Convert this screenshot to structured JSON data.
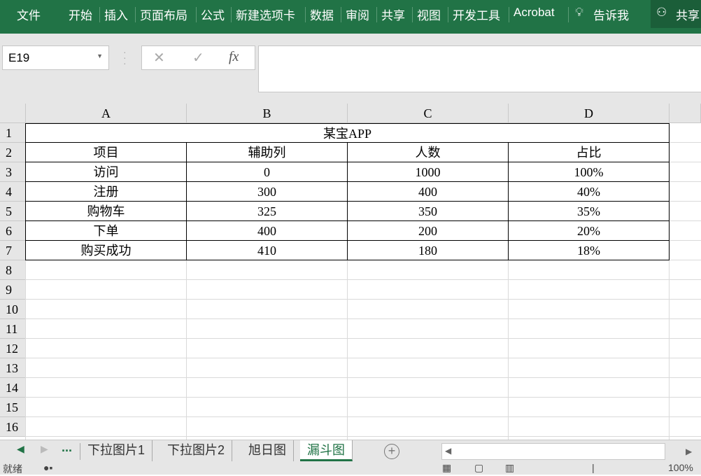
{
  "ribbon": {
    "tabs": [
      "文件",
      "开始",
      "插入",
      "页面布局",
      "公式",
      "新建选项卡",
      "数据",
      "审阅",
      "共享",
      "视图",
      "开发工具",
      "Acrobat"
    ],
    "tell_me": "告诉我",
    "share": "共享"
  },
  "formula_bar": {
    "name_box": "E19",
    "cancel": "✕",
    "enter": "✓",
    "fx": "fx",
    "value": ""
  },
  "columns": [
    "A",
    "B",
    "C",
    "D"
  ],
  "rows": [
    "1",
    "2",
    "3",
    "4",
    "5",
    "6",
    "7",
    "8",
    "9",
    "10",
    "11",
    "12",
    "13",
    "14",
    "15",
    "16"
  ],
  "table": {
    "title": "某宝APP",
    "headers": [
      "项目",
      "辅助列",
      "人数",
      "占比"
    ],
    "data": [
      [
        "访问",
        "0",
        "1000",
        "100%"
      ],
      [
        "注册",
        "300",
        "400",
        "40%"
      ],
      [
        "购物车",
        "325",
        "350",
        "35%"
      ],
      [
        "下单",
        "400",
        "200",
        "20%"
      ],
      [
        "购买成功",
        "410",
        "180",
        "18%"
      ]
    ]
  },
  "sheets": {
    "more": "...",
    "tabs": [
      "下拉图片1",
      "下拉图片2",
      "旭日图",
      "漏斗图"
    ],
    "active": "漏斗图",
    "add": "+"
  },
  "status": {
    "ready": "就绪",
    "zoom": "100%"
  }
}
